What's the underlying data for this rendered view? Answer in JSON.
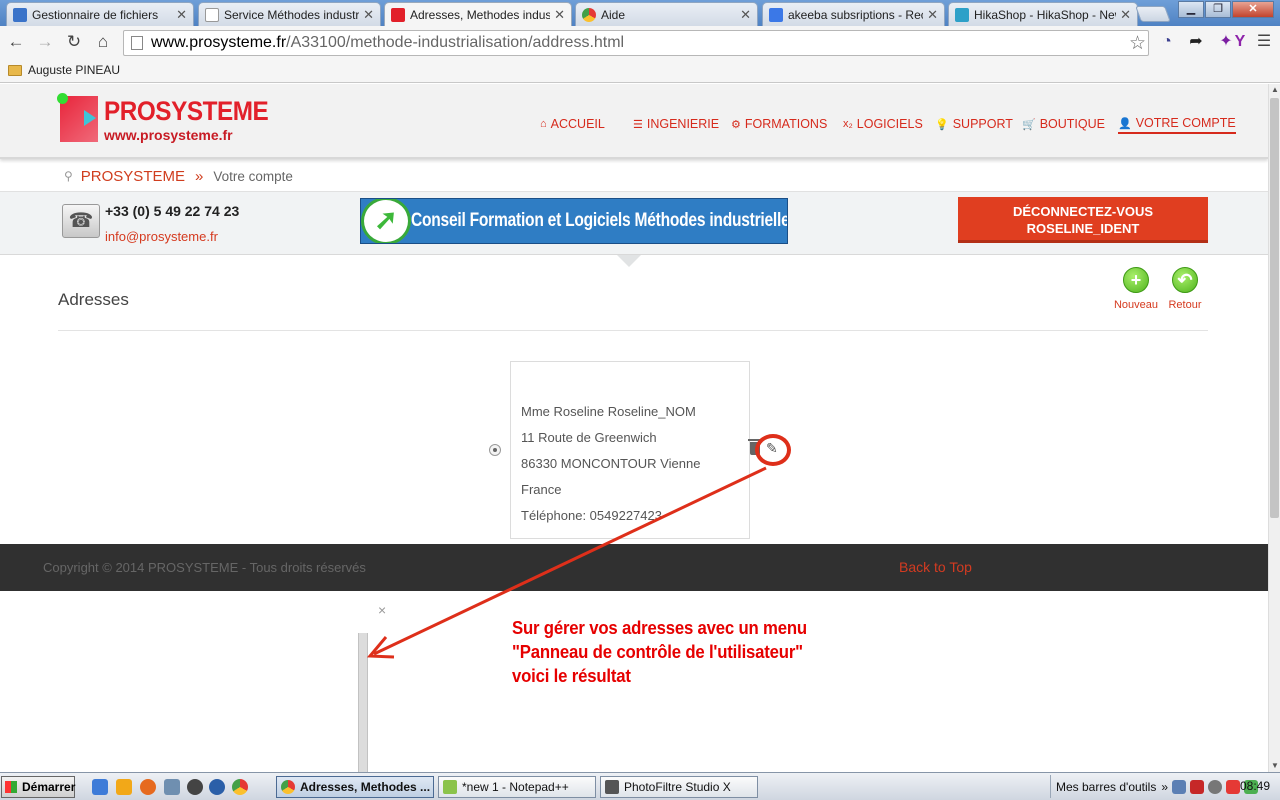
{
  "browser": {
    "tabs": [
      {
        "title": "Gestionnaire de fichiers",
        "icon": "cloud-sync-icon",
        "color": "#3a73c9"
      },
      {
        "title": "Service Méthodes industriel",
        "icon": "page-icon",
        "color": "#dddddd"
      },
      {
        "title": "Adresses, Methodes industri",
        "icon": "prosysteme-icon",
        "color": "#e2202a"
      },
      {
        "title": "Aide",
        "icon": "chrome-icon",
        "color": "#4caf50"
      },
      {
        "title": "akeeba subsriptions - Reche",
        "icon": "google-icon",
        "color": "#3b78e7"
      },
      {
        "title": "HikaShop - HikaShop - New",
        "icon": "hikashop-icon",
        "color": "#2da0c8"
      }
    ],
    "window_buttons": {
      "minimize": "▁",
      "maximize": "❐",
      "close": "✕"
    },
    "url_host": "www.prosysteme.fr",
    "url_path": "/A33100/methode-industrialisation/address.html",
    "bookmark": "Auguste PINEAU"
  },
  "site": {
    "logo_title": "PROSYSTEME",
    "logo_url": "www.prosysteme.fr",
    "nav": [
      {
        "label": "ACCUEIL",
        "icon": "home-icon",
        "glyph": "⌂"
      },
      {
        "label": "INGENIERIE",
        "icon": "list-icon",
        "glyph": "☰"
      },
      {
        "label": "FORMATIONS",
        "icon": "cogs-icon",
        "glyph": "⚙"
      },
      {
        "label": "LOGICIELS",
        "icon": "subscript-icon",
        "glyph": "x₂"
      },
      {
        "label": "SUPPORT",
        "icon": "lightbulb-icon",
        "glyph": "💡"
      },
      {
        "label": "BOUTIQUE",
        "icon": "cart-icon",
        "glyph": "🛒"
      },
      {
        "label": "VOTRE COMPTE",
        "icon": "user-icon",
        "glyph": "👤"
      }
    ],
    "breadcrumb": {
      "home": "PROSYSTEME",
      "separator": "»",
      "current": "Votre compte"
    },
    "contact": {
      "phone": "+33 (0) 5 49 22 74 23",
      "email": "info@prosysteme.fr"
    },
    "banner_text": "Conseil Formation et Logiciels Méthodes industrielles",
    "logout_line1": "DÉCONNECTEZ-VOUS",
    "logout_line2": "ROSELINE_IDENT",
    "section_title": "Adresses",
    "actions": {
      "new_label": "Nouveau",
      "back_label": "Retour"
    },
    "address": {
      "name": "Mme Roseline Roseline_NOM",
      "street": "11 Route de Greenwich",
      "city": "86330 MONCONTOUR Vienne",
      "country": "France",
      "phone": "Téléphone: 0549227423"
    },
    "footer": {
      "copyright": "Copyright © 2014 PROSYSTEME - Tous droits réservés",
      "back_to_top": "Back to Top"
    },
    "modal_close": "×",
    "annotation": [
      "Sur gérer vos adresses avec un menu",
      "\"Panneau de contrôle de l'utilisateur\"",
      "voici le résultat"
    ],
    "accent_color": "#d62a1c"
  },
  "taskbar": {
    "start_label": "Démarrer",
    "windows": [
      {
        "label": "Adresses, Methodes ...",
        "color": "#e2202a"
      },
      {
        "label": "*new 1 - Notepad++",
        "color": "#8bc34a"
      },
      {
        "label": "PhotoFiltre Studio X",
        "color": "#555555"
      }
    ],
    "toolbars_label": "Mes barres d'outils",
    "clock": "08:49"
  }
}
